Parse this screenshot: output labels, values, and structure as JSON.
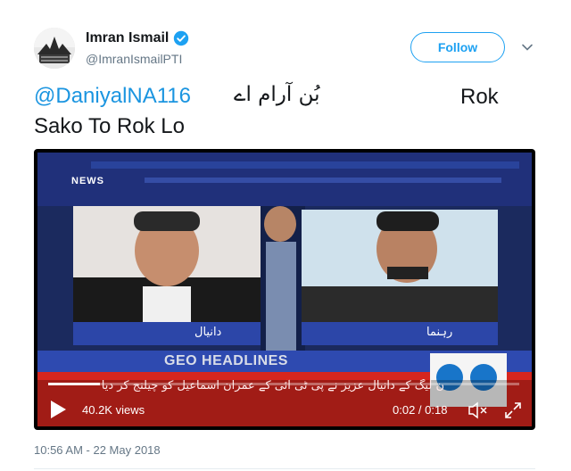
{
  "author": {
    "name": "Imran Ismail",
    "handle": "@ImranIsmailPTI"
  },
  "follow_button": {
    "label": "Follow"
  },
  "tweet": {
    "mention": "@DaniyalNA116",
    "urdu_text": "بُن آرام اے",
    "line1_tail": "Rok",
    "line2": "Sako To Rok Lo"
  },
  "video": {
    "views": "40.2K views",
    "time": "0:02 / 0:18",
    "progress_fraction": 0.11,
    "brand_text": "NEWS",
    "ticker_text": "GEO HEADLINES",
    "caption_urdu": "ن لیگ کے دانیال عزیز نے پی ٹی آئی کے عمران اسماعیل کو چیلنج کر دیا",
    "left_guest_caption": "دانیال",
    "right_guest_caption": "رہنما"
  },
  "timestamp": "10:56 AM - 22 May 2018",
  "colors": {
    "link_blue": "#1b95e0",
    "follow_blue": "#1da1f2",
    "verified_blue": "#1da1f2",
    "muted": "#657786",
    "ticker_red": "#d7261e"
  },
  "icons": {
    "verified": "verified-badge-icon",
    "chevron": "chevron-down-icon",
    "play": "play-icon",
    "mute": "volume-muted-icon",
    "fullscreen": "fullscreen-icon"
  }
}
